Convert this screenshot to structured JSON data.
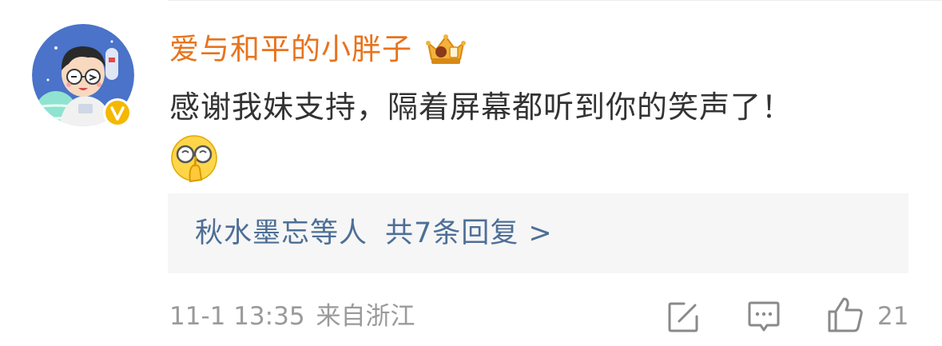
{
  "comment": {
    "username": "爱与和平的小胖子",
    "text": "感谢我妹支持，隔着屏幕都听到你的笑声了！",
    "replies": {
      "names": "秋水墨忘等人",
      "count_text": "共7条回复 >"
    },
    "meta": {
      "time": "11-1 13:35",
      "location": "来自浙江"
    },
    "likes": "21"
  },
  "icons": {
    "avatar": "cartoon-avatar-with-glasses",
    "verified": "verified-v-badge",
    "crown": "crown-fan-badge-icon",
    "emoji": "cover-face-laughing-emoji",
    "edit": "edit-icon",
    "comment": "comment-icon",
    "like": "thumbs-up-icon"
  },
  "colors": {
    "username": "#e8731d",
    "reply_link": "#4d6f96",
    "meta": "#9a9a9a",
    "verified": "#f5b800"
  }
}
